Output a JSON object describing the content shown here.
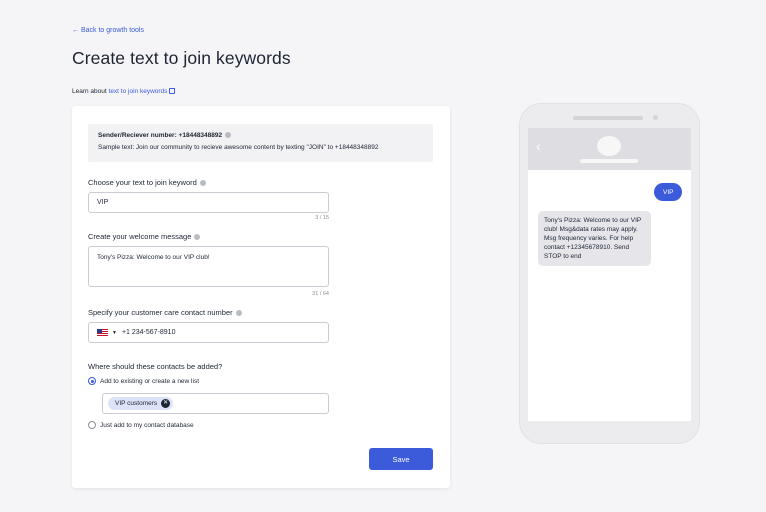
{
  "header": {
    "back_link": "← Back to growth tools",
    "title": "Create text to join keywords",
    "learn_prefix": "Learn about ",
    "learn_link": "text to join keywords"
  },
  "info": {
    "sender_label": "Sender/Reciever number: +18448348892",
    "sample_text": "Sample text: Join our community to recieve awesome content by texting \"JOIN\" to +18448348892"
  },
  "keyword": {
    "label": "Choose your text to join keyword",
    "value": "VIP",
    "counter": "3 / 15"
  },
  "welcome": {
    "label": "Create your welcome message",
    "value": "Tony's Pizza: Welcome to our VIP club!",
    "counter": "31 / 64"
  },
  "care": {
    "label": "Specify your customer care contact number",
    "country": "US",
    "phone": "+1 234-567-8910"
  },
  "contacts": {
    "label": "Where should these contacts be added?",
    "option1": "Add to existing or create a new list",
    "option2": "Just add to my contact database",
    "selected": "option1",
    "tag": "VIP customers"
  },
  "save_label": "Save",
  "preview": {
    "outgoing": "VIP",
    "incoming": "Tony's Pizza: Welcome to our VIP club! Msg&data rates may apply. Msg frequency varies. For help contact +12345678910. Send STOP to end"
  },
  "colors": {
    "accent": "#3b5bdb",
    "background": "#f5f5f7"
  }
}
